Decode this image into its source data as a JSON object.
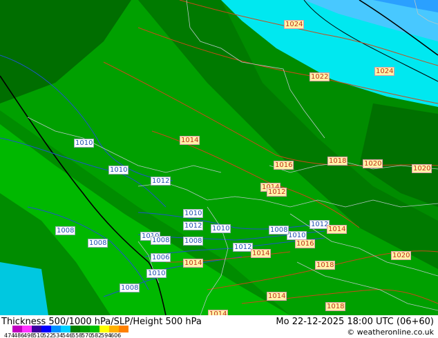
{
  "map": {
    "contour_labels_blue": [
      "1010",
      "1010",
      "1012",
      "1010",
      "1012",
      "1010",
      "1008",
      "1008",
      "1010",
      "1008",
      "1006",
      "1010",
      "1008",
      "1010",
      "1008",
      "1012",
      "1012",
      "1008"
    ],
    "contour_labels_red": [
      "1024",
      "1022",
      "1024",
      "1014",
      "1016",
      "1018",
      "1020",
      "1020",
      "1014",
      "1012",
      "1014",
      "1016",
      "1014",
      "1014",
      "1018",
      "1020",
      "1014",
      "1018",
      "1014"
    ]
  },
  "footer": {
    "title": "Thickness 500/1000 hPa/SLP/Height 500 hPa",
    "datetime": "Mo 22-12-2025 18:00 UTC (06+60)",
    "credit": "© weatheronline.co.uk",
    "legend_ticks": [
      "474",
      "486",
      "498",
      "510",
      "522",
      "534",
      "546",
      "558",
      "570",
      "582",
      "594",
      "606"
    ],
    "legend_colors": [
      "#c000c0",
      "#ff33ff",
      "#3a00a0",
      "#0000ff",
      "#0090ff",
      "#00d0ff",
      "#008000",
      "#00a000",
      "#00c000",
      "#ffff00",
      "#ffb000",
      "#ff8000"
    ]
  }
}
